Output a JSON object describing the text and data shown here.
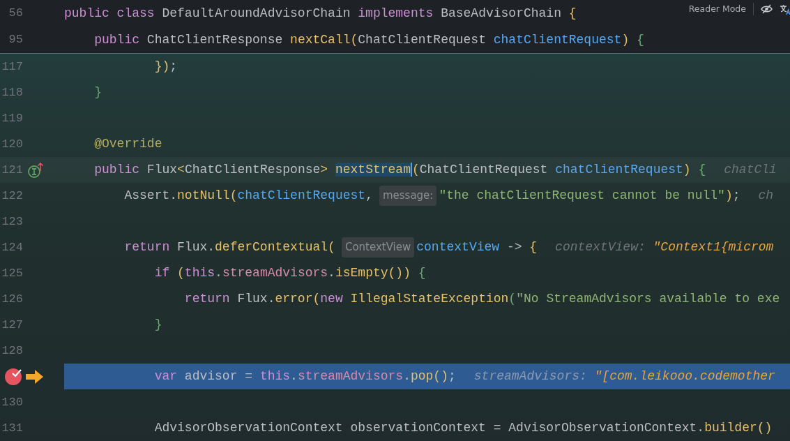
{
  "toolbar": {
    "reader_mode": "Reader Mode"
  },
  "sticky_lines": [
    {
      "number": "56",
      "segments": [
        {
          "kind": "code",
          "tokens": [
            {
              "t": "public class ",
              "kind": "kw"
            },
            {
              "t": "DefaultAroundAdvisorChain ",
              "kind": "plain"
            },
            {
              "t": "implements ",
              "kind": "kw"
            },
            {
              "t": "BaseAdvisorChain ",
              "kind": "plain"
            },
            {
              "t": "{",
              "kind": "brace-y"
            }
          ]
        }
      ]
    },
    {
      "number": "95",
      "segments": [
        {
          "kind": "code",
          "tokens": [
            {
              "t": "    public ",
              "kind": "kw"
            },
            {
              "t": "ChatClientResponse ",
              "kind": "plain"
            },
            {
              "t": "nextCall",
              "kind": "fn"
            },
            {
              "t": "(",
              "kind": "brace-y"
            },
            {
              "t": "ChatClientRequest ",
              "kind": "plain"
            },
            {
              "t": "chatClientRequest",
              "kind": "param"
            },
            {
              "t": ") ",
              "kind": "brace-y"
            },
            {
              "t": "{",
              "kind": "brace-g"
            }
          ]
        }
      ]
    }
  ],
  "lines": [
    {
      "number": "117",
      "segments": [
        {
          "kind": "code",
          "tokens": [
            {
              "t": "            })",
              "kind": "brace-y"
            },
            {
              "t": ";",
              "kind": "plain"
            }
          ]
        }
      ]
    },
    {
      "number": "118",
      "segments": [
        {
          "kind": "code",
          "tokens": [
            {
              "t": "    }",
              "kind": "brace-g"
            }
          ]
        }
      ]
    },
    {
      "number": "119"
    },
    {
      "number": "120",
      "segments": [
        {
          "kind": "code",
          "tokens": [
            {
              "t": "    @Override",
              "kind": "annot"
            }
          ]
        }
      ]
    },
    {
      "number": "121",
      "caret_line": true,
      "gutter": [
        {
          "kind": "implements-up"
        }
      ],
      "segments": [
        {
          "kind": "code",
          "tokens": [
            {
              "t": "    public ",
              "kind": "kw"
            },
            {
              "t": "Flux",
              "kind": "plain"
            },
            {
              "t": "<",
              "kind": "fn"
            },
            {
              "t": "ChatClientResponse",
              "kind": "plain"
            },
            {
              "t": "> ",
              "kind": "fn"
            },
            {
              "t": "nextStream",
              "kind": "fn",
              "highlight": true,
              "caret": true
            },
            {
              "t": "(",
              "kind": "brace-y"
            },
            {
              "t": "ChatClientRequest ",
              "kind": "plain"
            },
            {
              "t": "chatClientRequest",
              "kind": "param"
            },
            {
              "t": ") ",
              "kind": "brace-y"
            },
            {
              "t": "{",
              "kind": "brace-g"
            }
          ]
        },
        {
          "kind": "debug",
          "label": "chatCli"
        }
      ]
    },
    {
      "number": "122",
      "segments": [
        {
          "kind": "code",
          "tokens": [
            {
              "t": "        Assert.",
              "kind": "plain"
            },
            {
              "t": "notNull",
              "kind": "fn"
            },
            {
              "t": "(",
              "kind": "brace-y"
            },
            {
              "t": "chatClientRequest",
              "kind": "param"
            },
            {
              "t": ",",
              "kind": "plain"
            }
          ]
        },
        {
          "kind": "hint",
          "text": "message:"
        },
        {
          "kind": "code",
          "tokens": [
            {
              "t": "\"the chatClientRequest cannot be null\"",
              "kind": "str"
            },
            {
              "t": ")",
              "kind": "brace-y"
            },
            {
              "t": ";",
              "kind": "plain"
            }
          ]
        },
        {
          "kind": "debug",
          "label": "ch"
        }
      ]
    },
    {
      "number": "123"
    },
    {
      "number": "124",
      "segments": [
        {
          "kind": "code",
          "tokens": [
            {
              "t": "        return ",
              "kind": "kw"
            },
            {
              "t": "Flux.",
              "kind": "plain"
            },
            {
              "t": "deferContextual",
              "kind": "fn"
            },
            {
              "t": "(",
              "kind": "brace-y"
            }
          ]
        },
        {
          "kind": "hint",
          "text": "ContextView"
        },
        {
          "kind": "code",
          "tokens": [
            {
              "t": "contextView ",
              "kind": "param"
            },
            {
              "t": "-> ",
              "kind": "plain"
            },
            {
              "t": "{",
              "kind": "brace-y"
            }
          ]
        },
        {
          "kind": "debug",
          "label": "contextView:",
          "value": "\"Context1{microm"
        }
      ]
    },
    {
      "number": "125",
      "segments": [
        {
          "kind": "code",
          "tokens": [
            {
              "t": "            if ",
              "kind": "kw"
            },
            {
              "t": "(",
              "kind": "brace-y"
            },
            {
              "t": "this",
              "kind": "kw"
            },
            {
              "t": ".",
              "kind": "plain"
            },
            {
              "t": "streamAdvisors",
              "kind": "field"
            },
            {
              "t": ".",
              "kind": "plain"
            },
            {
              "t": "isEmpty",
              "kind": "fn"
            },
            {
              "t": "()) ",
              "kind": "brace-y"
            },
            {
              "t": "{",
              "kind": "brace-g"
            }
          ]
        }
      ]
    },
    {
      "number": "126",
      "segments": [
        {
          "kind": "code",
          "tokens": [
            {
              "t": "                return ",
              "kind": "kw"
            },
            {
              "t": "Flux.",
              "kind": "plain"
            },
            {
              "t": "error",
              "kind": "fn"
            },
            {
              "t": "(",
              "kind": "brace-y"
            },
            {
              "t": "new ",
              "kind": "kw"
            },
            {
              "t": "IllegalStateException",
              "kind": "fn"
            },
            {
              "t": "(",
              "kind": "brace-g"
            },
            {
              "t": "\"No StreamAdvisors available to exe",
              "kind": "str"
            }
          ]
        }
      ]
    },
    {
      "number": "127",
      "segments": [
        {
          "kind": "code",
          "tokens": [
            {
              "t": "            }",
              "kind": "brace-g"
            }
          ]
        }
      ]
    },
    {
      "number": "128"
    },
    {
      "current": true,
      "gutter": [
        {
          "kind": "breakpoint"
        },
        {
          "kind": "execution-point"
        }
      ],
      "segments": [
        {
          "kind": "code",
          "tokens": [
            {
              "t": "            var ",
              "kind": "kw"
            },
            {
              "t": "advisor = ",
              "kind": "plain"
            },
            {
              "t": "this",
              "kind": "kw"
            },
            {
              "t": ".",
              "kind": "plain"
            },
            {
              "t": "streamAdvisors",
              "kind": "field"
            },
            {
              "t": ".",
              "kind": "plain"
            },
            {
              "t": "pop",
              "kind": "fn"
            },
            {
              "t": "()",
              "kind": "brace-y"
            },
            {
              "t": ";",
              "kind": "plain"
            }
          ]
        },
        {
          "kind": "debug",
          "label": "streamAdvisors:",
          "value": "\"[com.leikooo.codemother"
        }
      ]
    },
    {
      "number": "130"
    },
    {
      "number": "131",
      "segments": [
        {
          "kind": "code",
          "tokens": [
            {
              "t": "            AdvisorObservationContext observationContext = AdvisorObservationContext.",
              "kind": "plain"
            },
            {
              "t": "builder",
              "kind": "fn"
            },
            {
              "t": "()",
              "kind": "brace-y"
            }
          ]
        }
      ]
    }
  ]
}
